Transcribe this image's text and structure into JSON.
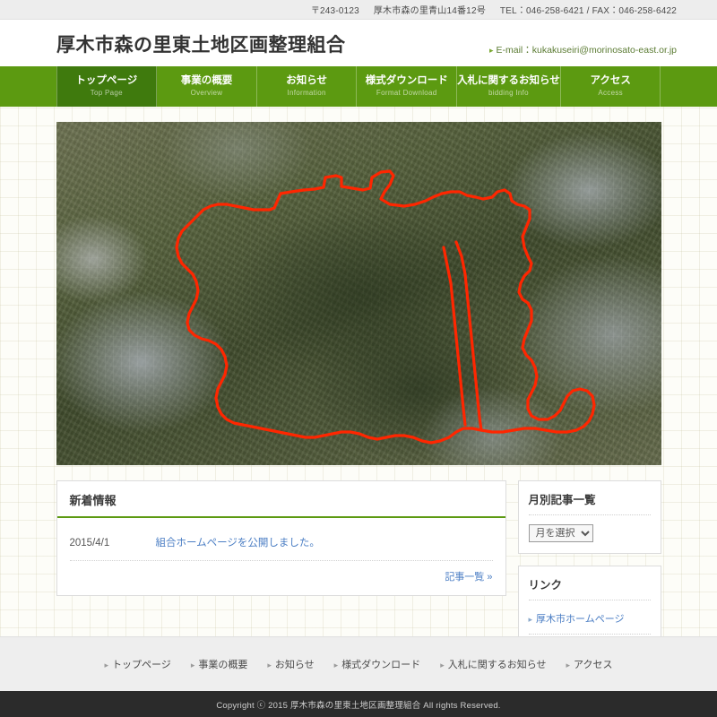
{
  "topbar": {
    "postal": "〒243-0123",
    "address": "厚木市森の里青山14番12号",
    "tel_fax": "TEL：046-258-6421 / FAX：046-258-6422"
  },
  "header": {
    "site_title": "厚木市森の里東土地区画整理組合",
    "email_label": "E-mail：kukakuseiri@morinosato-east.or.jp"
  },
  "global_nav": [
    {
      "ja": "トップページ",
      "en": "Top Page",
      "active": true
    },
    {
      "ja": "事業の概要",
      "en": "Overview",
      "active": false
    },
    {
      "ja": "お知らせ",
      "en": "Information",
      "active": false
    },
    {
      "ja": "様式ダウンロード",
      "en": "Format Download",
      "active": false
    },
    {
      "ja": "入札に関するお知らせ",
      "en": "bidding Info",
      "active": false
    },
    {
      "ja": "アクセス",
      "en": "Access",
      "active": false
    }
  ],
  "hero": {
    "alt": "aerial-photo-of-project-area",
    "boundary_color": "#ff2600"
  },
  "news": {
    "title": "新着情報",
    "items": [
      {
        "date": "2015/4/1",
        "text": "組合ホームページを公開しました。"
      }
    ],
    "more_label": "記事一覧 »"
  },
  "sidebar": {
    "archive": {
      "title": "月別記事一覧",
      "select_value": "月を選択"
    },
    "links": {
      "title": "リンク",
      "items": [
        {
          "label": "厚木市ホームページ"
        }
      ]
    }
  },
  "footer": {
    "nav": [
      "トップページ",
      "事業の概要",
      "お知らせ",
      "様式ダウンロード",
      "入札に関するお知らせ",
      "アクセス"
    ],
    "copyright": "Copyright ⓒ 2015 厚木市森の里東土地区画整理組合 All rights Reserved."
  },
  "colors": {
    "nav_green": "#5c9a11",
    "nav_green_active": "#3f7a0d",
    "link_blue": "#4b7ec4",
    "boundary_red": "#ff2600",
    "footer_dark": "#2b2b2b"
  }
}
